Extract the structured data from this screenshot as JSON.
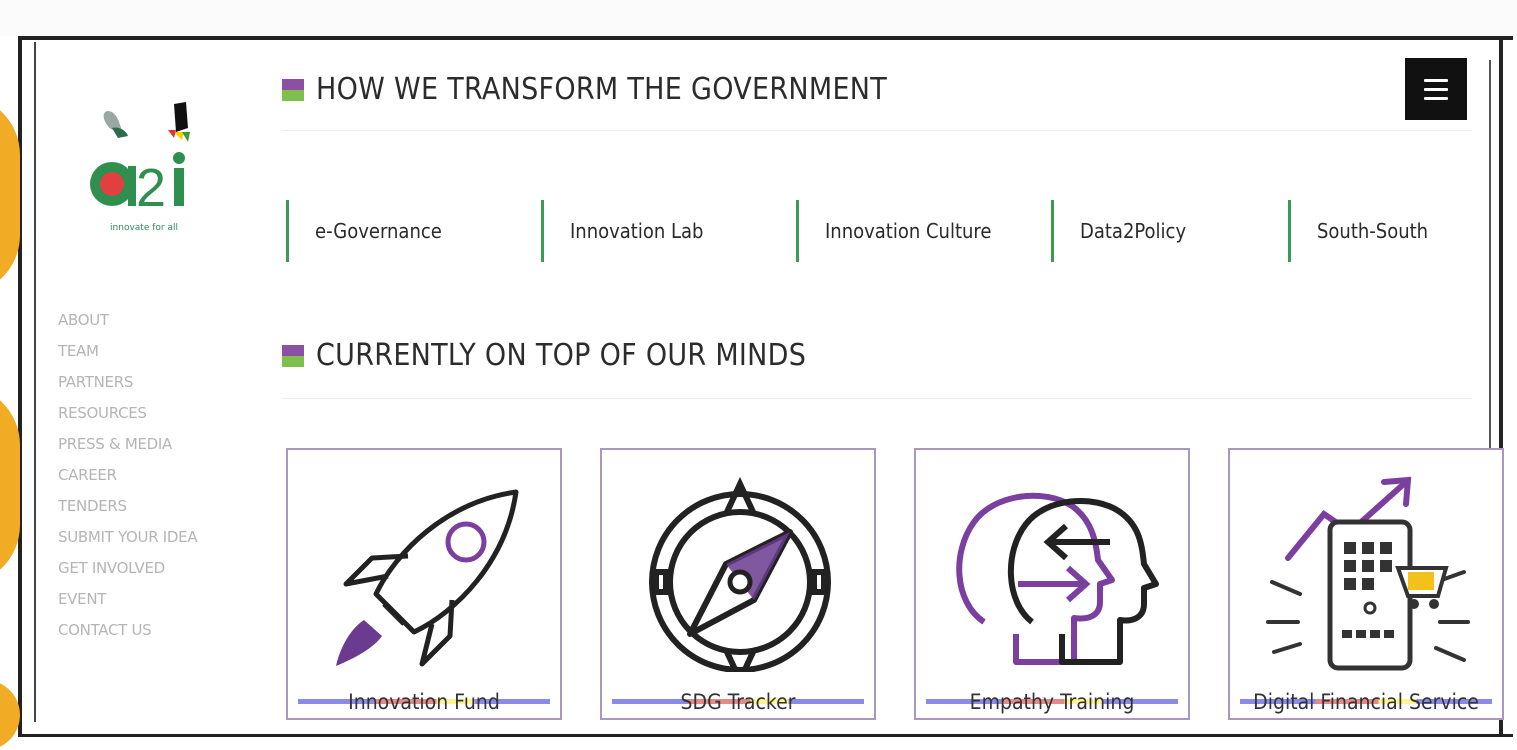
{
  "logo": {
    "tagline": "innovate for all"
  },
  "sidebar": {
    "items": [
      {
        "label": "ABOUT"
      },
      {
        "label": "TEAM"
      },
      {
        "label": "PARTNERS"
      },
      {
        "label": "RESOURCES"
      },
      {
        "label": "PRESS & MEDIA"
      },
      {
        "label": "CAREER"
      },
      {
        "label": "TENDERS"
      },
      {
        "label": "SUBMIT YOUR IDEA"
      },
      {
        "label": "GET INVOLVED"
      },
      {
        "label": "EVENT"
      },
      {
        "label": "CONTACT US"
      }
    ]
  },
  "sections": {
    "transform": {
      "title": "HOW WE TRANSFORM THE GOVERNMENT",
      "tabs": [
        {
          "label": "e-Governance"
        },
        {
          "label": "Innovation Lab"
        },
        {
          "label": "Innovation Culture"
        },
        {
          "label": "Data2Policy"
        },
        {
          "label": "South-South"
        }
      ]
    },
    "minds": {
      "title": "CURRENTLY ON TOP OF OUR MINDS",
      "cards": [
        {
          "label": "Innovation Fund",
          "icon": "rocket-icon"
        },
        {
          "label": "SDG Tracker",
          "icon": "compass-icon"
        },
        {
          "label": "Empathy Training",
          "icon": "heads-icon"
        },
        {
          "label": "Digital Financial Service",
          "icon": "mobile-commerce-icon"
        }
      ]
    }
  },
  "colors": {
    "accent_purple": "#8d4ea6",
    "accent_green": "#7fbf4d",
    "tab_border": "#3b9a55",
    "side_bar": "#f2ab24"
  }
}
